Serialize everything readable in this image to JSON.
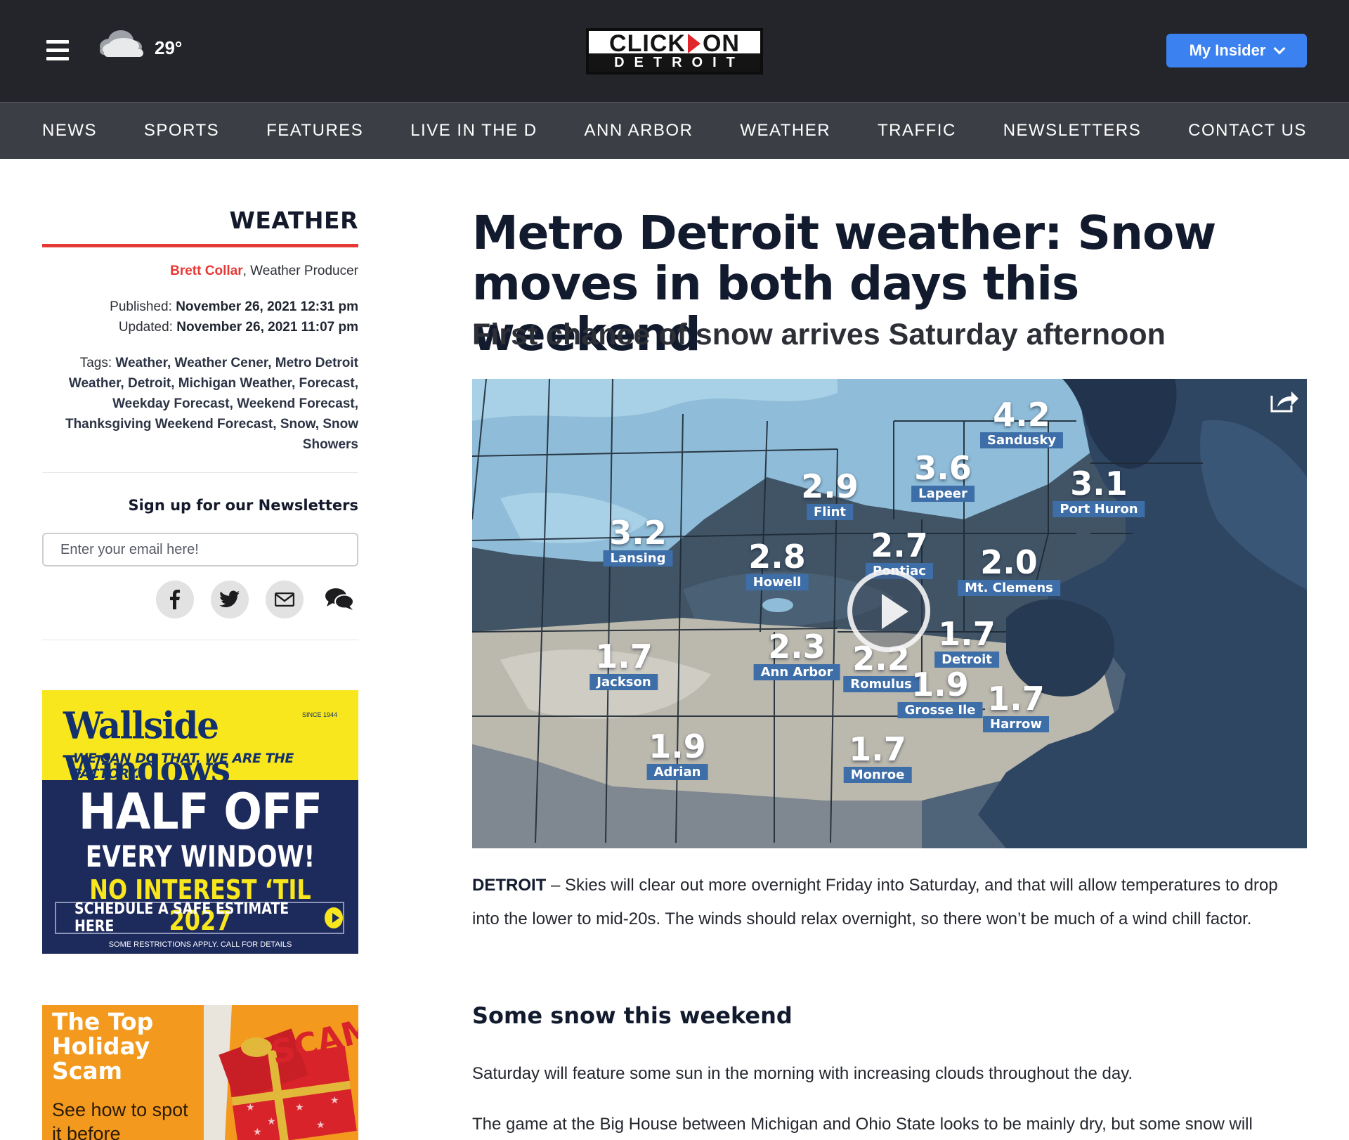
{
  "header": {
    "temperature": "29°",
    "weather_icon": "cloud-icon",
    "logo_top_left": "CLICK",
    "logo_top_right": "ON",
    "logo_bottom": "DETROIT",
    "insider_label": "My Insider"
  },
  "nav": [
    "NEWS",
    "SPORTS",
    "FEATURES",
    "LIVE IN THE D",
    "ANN ARBOR",
    "WEATHER",
    "TRAFFIC",
    "NEWSLETTERS",
    "CONTACT US"
  ],
  "sidebar": {
    "section": "WEATHER",
    "author": "Brett Collar",
    "author_role": ", Weather Producer",
    "published_label": "Published:",
    "published": "November 26, 2021 12:31 pm",
    "updated_label": "Updated:",
    "updated": "November 26, 2021 11:07 pm",
    "tags_label": "Tags:",
    "tags": "Weather, Weather Cener, Metro Detroit Weather, Detroit, Michigan Weather, Forecast, Weekday Forecast, Weekend Forecast, Thanksgiving Weekend Forecast, Snow, Snow Showers",
    "newsletter_title": "Sign up for our Newsletters",
    "email_placeholder": "Enter your email here!",
    "share_icons": [
      "facebook-icon",
      "twitter-icon",
      "email-icon",
      "comments-icon"
    ]
  },
  "ads": {
    "wallside": {
      "brand": "Wallside Windows",
      "since": "SINCE 1944",
      "slogan": "WE CAN DO THAT. WE ARE THE FACTORY.",
      "headline": "HALF OFF",
      "subline": "EVERY WINDOW!",
      "interest": "NO INTEREST ‘TIL 2027",
      "cta": "SCHEDULE A SAFE ESTIMATE HERE",
      "fine_print": "SOME RESTRICTIONS APPLY. CALL FOR DETAILS"
    },
    "scam": {
      "title": "The Top Holiday Scam",
      "subtitle": "See how to spot it before",
      "stamp": "SCAM"
    }
  },
  "article": {
    "headline": "Metro Detroit weather: Snow moves in both days this weekend",
    "subhead": "First chance of snow arrives Saturday afternoon",
    "dateline": "DETROIT",
    "para1": " – Skies will clear out more overnight Friday into Saturday, and that will allow temperatures to drop into the lower to mid-20s. The winds should relax overnight, so there won’t be much of a wind chill factor.",
    "section_heading": "Some snow this weekend",
    "para2": "Saturday will feature some sun in the morning with increasing clouds throughout the day.",
    "para3": "The game at the Big House between Michigan and Ohio State looks to be mainly dry, but some snow will"
  },
  "map": {
    "labels": [
      {
        "value": "4.2",
        "city": "Sandusky"
      },
      {
        "value": "3.6",
        "city": "Lapeer"
      },
      {
        "value": "3.1",
        "city": "Port Huron"
      },
      {
        "value": "2.9",
        "city": "Flint"
      },
      {
        "value": "3.2",
        "city": "Lansing"
      },
      {
        "value": "2.8",
        "city": "Howell"
      },
      {
        "value": "2.7",
        "city": "Pontiac"
      },
      {
        "value": "2.0",
        "city": "Mt. Clemens"
      },
      {
        "value": "1.7",
        "city": "Detroit"
      },
      {
        "value": "2.3",
        "city": "Ann Arbor"
      },
      {
        "value": "2.2",
        "city": "Romulus"
      },
      {
        "value": "1.7",
        "city": "Jackson"
      },
      {
        "value": "1.9",
        "city": "Grosse Ile"
      },
      {
        "value": "1.7",
        "city": "Harrow"
      },
      {
        "value": "1.9",
        "city": "Adrian"
      },
      {
        "value": "1.7",
        "city": "Monroe"
      }
    ]
  }
}
